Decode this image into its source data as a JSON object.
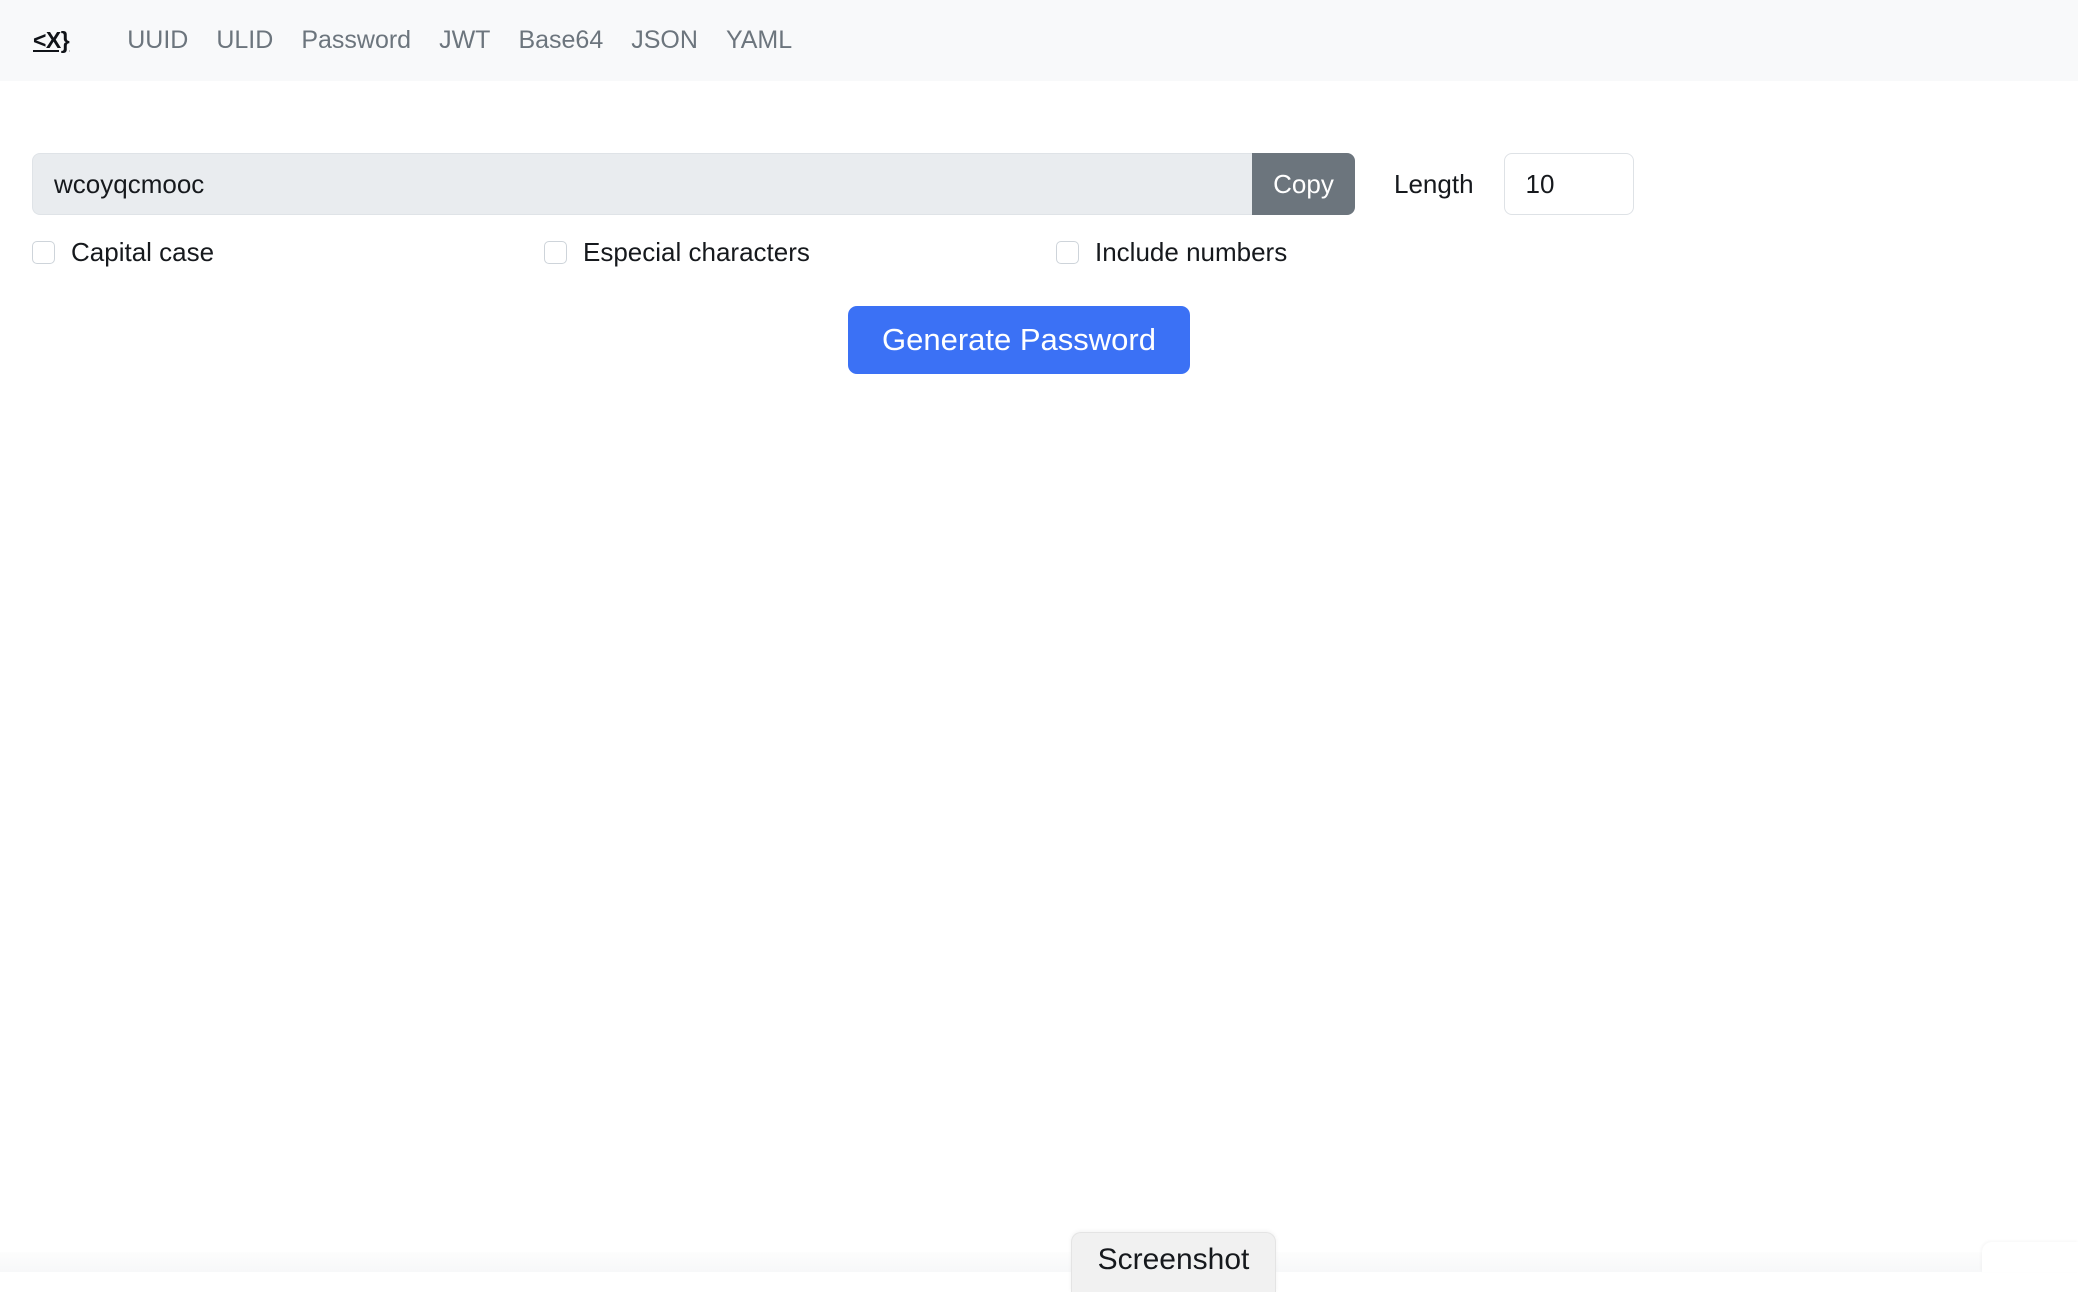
{
  "navbar": {
    "brand": "<X}",
    "links": [
      {
        "label": "UUID"
      },
      {
        "label": "ULID"
      },
      {
        "label": "Password"
      },
      {
        "label": "JWT"
      },
      {
        "label": "Base64"
      },
      {
        "label": "JSON"
      },
      {
        "label": "YAML"
      }
    ]
  },
  "generator": {
    "password_value": "wcoyqcmooc",
    "password_placeholder": "",
    "copy_label": "Copy",
    "length_label": "Length",
    "length_value": "10",
    "length_placeholder": "",
    "options": [
      {
        "label": "Capital case",
        "checked": false
      },
      {
        "label": "Especial characters",
        "checked": false
      },
      {
        "label": "Include numbers",
        "checked": false
      }
    ],
    "generate_label": "Generate Password"
  },
  "overlay": {
    "screenshot_label": "Screenshot"
  },
  "colors": {
    "navbar_bg": "#f8f9fa",
    "nav_link": "#6c757d",
    "primary": "#3b71f5",
    "secondary": "#6c757d",
    "input_disabled_bg": "#e9ecef",
    "border": "#dee2e6",
    "text": "#16191d",
    "page_bg": "#ffffff"
  }
}
